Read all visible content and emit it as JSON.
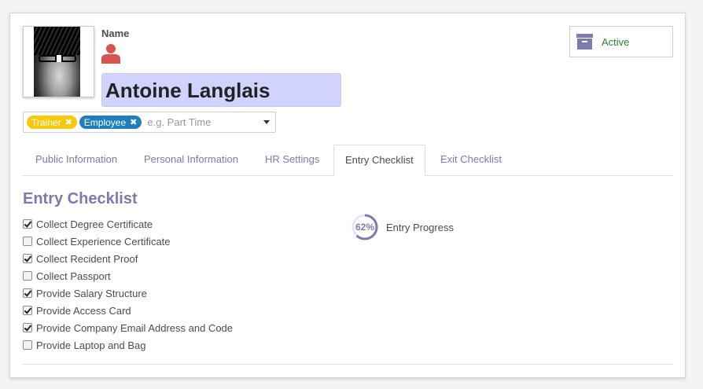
{
  "employee": {
    "name_label": "Name",
    "name": "Antoine Langlais",
    "tags": [
      {
        "label": "Trainer",
        "color": "#f6c90e"
      },
      {
        "label": "Employee",
        "color": "#1f7fbd"
      }
    ],
    "tags_placeholder": "e.g. Part Time",
    "status_label": "Active"
  },
  "tabs": [
    {
      "label": "Public Information",
      "active": false
    },
    {
      "label": "Personal Information",
      "active": false
    },
    {
      "label": "HR Settings",
      "active": false
    },
    {
      "label": "Entry Checklist",
      "active": true
    },
    {
      "label": "Exit Checklist",
      "active": false
    }
  ],
  "entry_checklist": {
    "title": "Entry Checklist",
    "items": [
      {
        "label": "Collect Degree Certificate",
        "checked": true
      },
      {
        "label": "Collect Experience Certificate",
        "checked": false
      },
      {
        "label": "Collect Recident Proof",
        "checked": true
      },
      {
        "label": "Collect Passport",
        "checked": false
      },
      {
        "label": "Provide Salary Structure",
        "checked": true
      },
      {
        "label": "Provide Access Card",
        "checked": true
      },
      {
        "label": "Provide Company Email Address and Code",
        "checked": true
      },
      {
        "label": "Provide Laptop and Bag",
        "checked": false
      }
    ],
    "progress_text": "62%",
    "progress_value": 0.62,
    "progress_label": "Entry Progress"
  },
  "colors": {
    "accent": "#7c7bad",
    "name_field_bg": "#d2d2ff",
    "person_icon": "#d9534f",
    "status_text": "#2e7d32"
  },
  "icons": {
    "person": "person-icon",
    "archive": "archive-icon",
    "remove_tag": "close-icon",
    "dropdown": "caret-down-icon"
  }
}
